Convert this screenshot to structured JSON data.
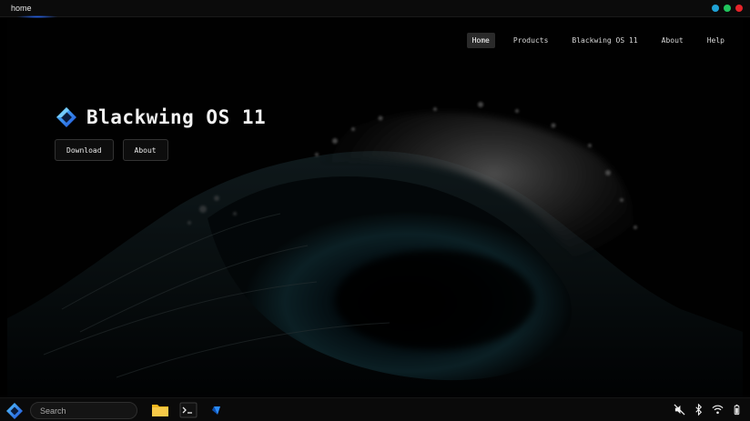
{
  "window": {
    "title": "home",
    "controls": [
      {
        "name": "minimize",
        "color": "#1fa2d6"
      },
      {
        "name": "maximize",
        "color": "#21c55d"
      },
      {
        "name": "close",
        "color": "#e5242a"
      }
    ]
  },
  "nav": {
    "items": [
      {
        "label": "Home",
        "active": true
      },
      {
        "label": "Products",
        "active": false
      },
      {
        "label": "Blackwing OS 11",
        "active": false
      },
      {
        "label": "About",
        "active": false
      },
      {
        "label": "Help",
        "active": false
      }
    ]
  },
  "hero": {
    "logo_icon": "blackwing-logo-icon",
    "title": "Blackwing OS 11",
    "buttons": {
      "download_label": "Download",
      "about_label": "About"
    },
    "background": "ocean-wave-image"
  },
  "taskbar": {
    "start_icon": "blackwing-logo-icon",
    "search_placeholder": "Search",
    "apps": [
      "folder-icon",
      "terminal-icon",
      "blackwing-app-icon"
    ],
    "tray": [
      "mute-icon",
      "bluetooth-icon",
      "wifi-icon",
      "battery-icon"
    ]
  },
  "colors": {
    "accent": "#2a6bff",
    "background": "#000000"
  }
}
